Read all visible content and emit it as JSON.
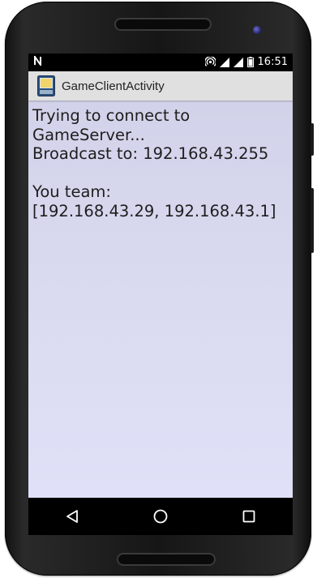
{
  "status_bar": {
    "carrier_icon": "nfc-n-icon",
    "icons": [
      "hotspot-icon",
      "signal-icon",
      "signal-icon",
      "battery-icon"
    ],
    "time": "16:51"
  },
  "action_bar": {
    "app_icon": "app-icon",
    "title": "GameClientActivity"
  },
  "content": {
    "line1": "Trying to connect to",
    "line2": "GameServer...",
    "line3": "Broadcast to: 192.168.43.255",
    "line4": "",
    "line5": "You team:",
    "line6": "[192.168.43.29, 192.168.43.1]"
  },
  "nav_bar": {
    "back_icon": "back-triangle-icon",
    "home_icon": "home-circle-icon",
    "recents_icon": "recents-square-icon"
  },
  "colors": {
    "action_bar_bg": "#e0e0e0",
    "content_bg_top": "#d2d2ea",
    "content_bg_bottom": "#e0e0f8",
    "phone_body": "#161616",
    "camera": "#3b3b9a"
  }
}
